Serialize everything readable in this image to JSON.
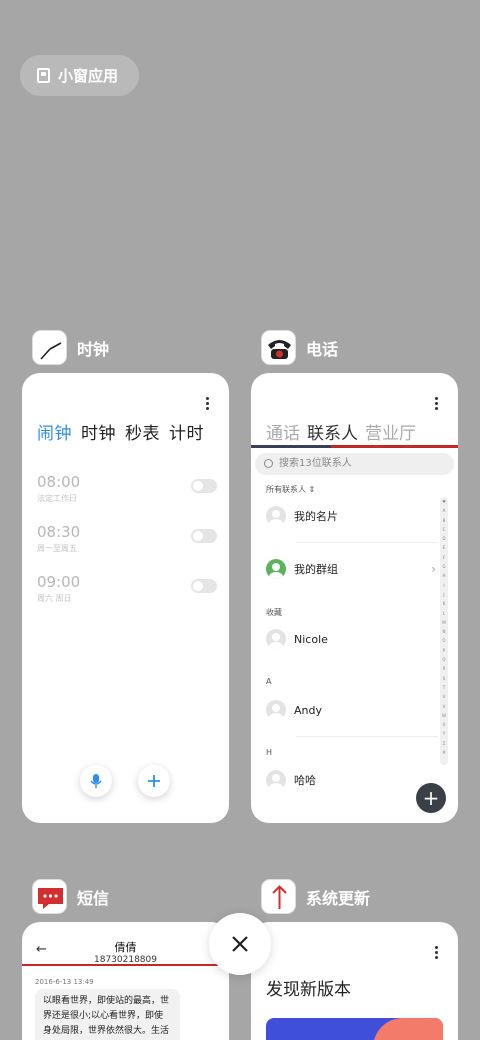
{
  "small_window": {
    "label": "小窗应用",
    "icon": "phone-window-icon"
  },
  "clock": {
    "app_name": "时钟",
    "icon": "clock-icon",
    "tabs": [
      {
        "label": "闹钟",
        "active": true
      },
      {
        "label": "时钟",
        "active": false
      },
      {
        "label": "秒表",
        "active": false
      },
      {
        "label": "计时",
        "active": false
      }
    ],
    "alarms": [
      {
        "time": "08:00",
        "repeat": "法定工作日",
        "enabled": false
      },
      {
        "time": "08:30",
        "repeat": "周一至周五",
        "enabled": false
      },
      {
        "time": "09:00",
        "repeat": "周六 周日",
        "enabled": false
      }
    ],
    "accent": "#2c8ee8"
  },
  "phone": {
    "app_name": "电话",
    "icon": "telephone-icon",
    "tabs": [
      {
        "label": "通话",
        "active": false
      },
      {
        "label": "联系人",
        "active": true
      },
      {
        "label": "营业厅",
        "active": false
      }
    ],
    "search_placeholder": "搜索13位联系人",
    "all_contacts_label": "所有联系人",
    "my_card": "我的名片",
    "my_groups": "我的群组",
    "sections": [
      {
        "header": "收藏",
        "name": "Nicole"
      },
      {
        "header": "A",
        "name": "Andy"
      },
      {
        "header": "H",
        "name": "哈哈"
      }
    ],
    "index_letters": "♥ABCDEFGHIJKLMNOPQRSTUVWXYZ#"
  },
  "sms": {
    "app_name": "短信",
    "icon": "message-icon",
    "contact_name": "倩倩",
    "contact_number": "18730218809",
    "date": "2016-6-13 13:49",
    "message": "以眼看世界，即使站的最高，世界还是很小;以心看世界，即使身处局限，世界依然很大。生活远不完美，需要用心去体会;正因为生活..."
  },
  "update": {
    "app_name": "系统更新",
    "icon": "upload-arrow-icon",
    "title": "发现新版本"
  },
  "colors": {
    "background": "#a6a6a6",
    "red": "#c62828"
  }
}
